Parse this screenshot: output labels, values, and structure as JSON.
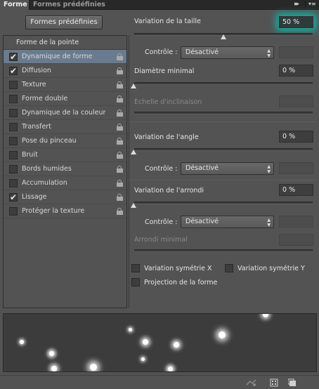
{
  "tabs": {
    "active_label": "Forme",
    "inactive_label": "Formes prédéfinies"
  },
  "presets_button_label": "Formes prédéfinies",
  "brush_list": {
    "header": "Forme de la pointe",
    "items": [
      {
        "label": "Dynamique de forme",
        "checked": true,
        "selected": true
      },
      {
        "label": "Diffusion",
        "checked": true
      },
      {
        "label": "Texture",
        "checked": false
      },
      {
        "label": "Forme double",
        "checked": false
      },
      {
        "label": "Dynamique de la couleur",
        "checked": false
      },
      {
        "label": "Transfert",
        "checked": false
      },
      {
        "label": "Pose du pinceau",
        "checked": false
      },
      {
        "label": "Bruit",
        "checked": false
      },
      {
        "label": "Bords humides",
        "checked": false
      },
      {
        "label": "Accumulation",
        "checked": false
      },
      {
        "label": "Lissage",
        "checked": true
      },
      {
        "label": "Protéger la texture",
        "checked": false
      }
    ]
  },
  "size_jitter": {
    "label": "Variation de la taille",
    "value": "50 %",
    "slider_fraction": 0.5,
    "control_label": "Contrôle :",
    "control_value": "Désactivé"
  },
  "min_diameter": {
    "label": "Diamètre minimal",
    "value": "0 %"
  },
  "tilt_scale": {
    "label": "Echelle d'inclinaison"
  },
  "angle_jitter": {
    "label": "Variation de l'angle",
    "value": "0 %",
    "control_label": "Contrôle :",
    "control_value": "Désactivé"
  },
  "roundness_jitter": {
    "label": "Variation de l'arrondi",
    "value": "0 %",
    "control_label": "Contrôle :",
    "control_value": "Désactivé"
  },
  "min_roundness": {
    "label": "Arrondi minimal"
  },
  "checkboxes": {
    "flip_x": "Variation symétrie X",
    "flip_y": "Variation symétrie Y",
    "brush_projection": "Projection de la forme"
  },
  "colors": {
    "panel_bg": "#535353",
    "selected_row": "#6a7b90",
    "focus_glow": "#11b3a8"
  }
}
